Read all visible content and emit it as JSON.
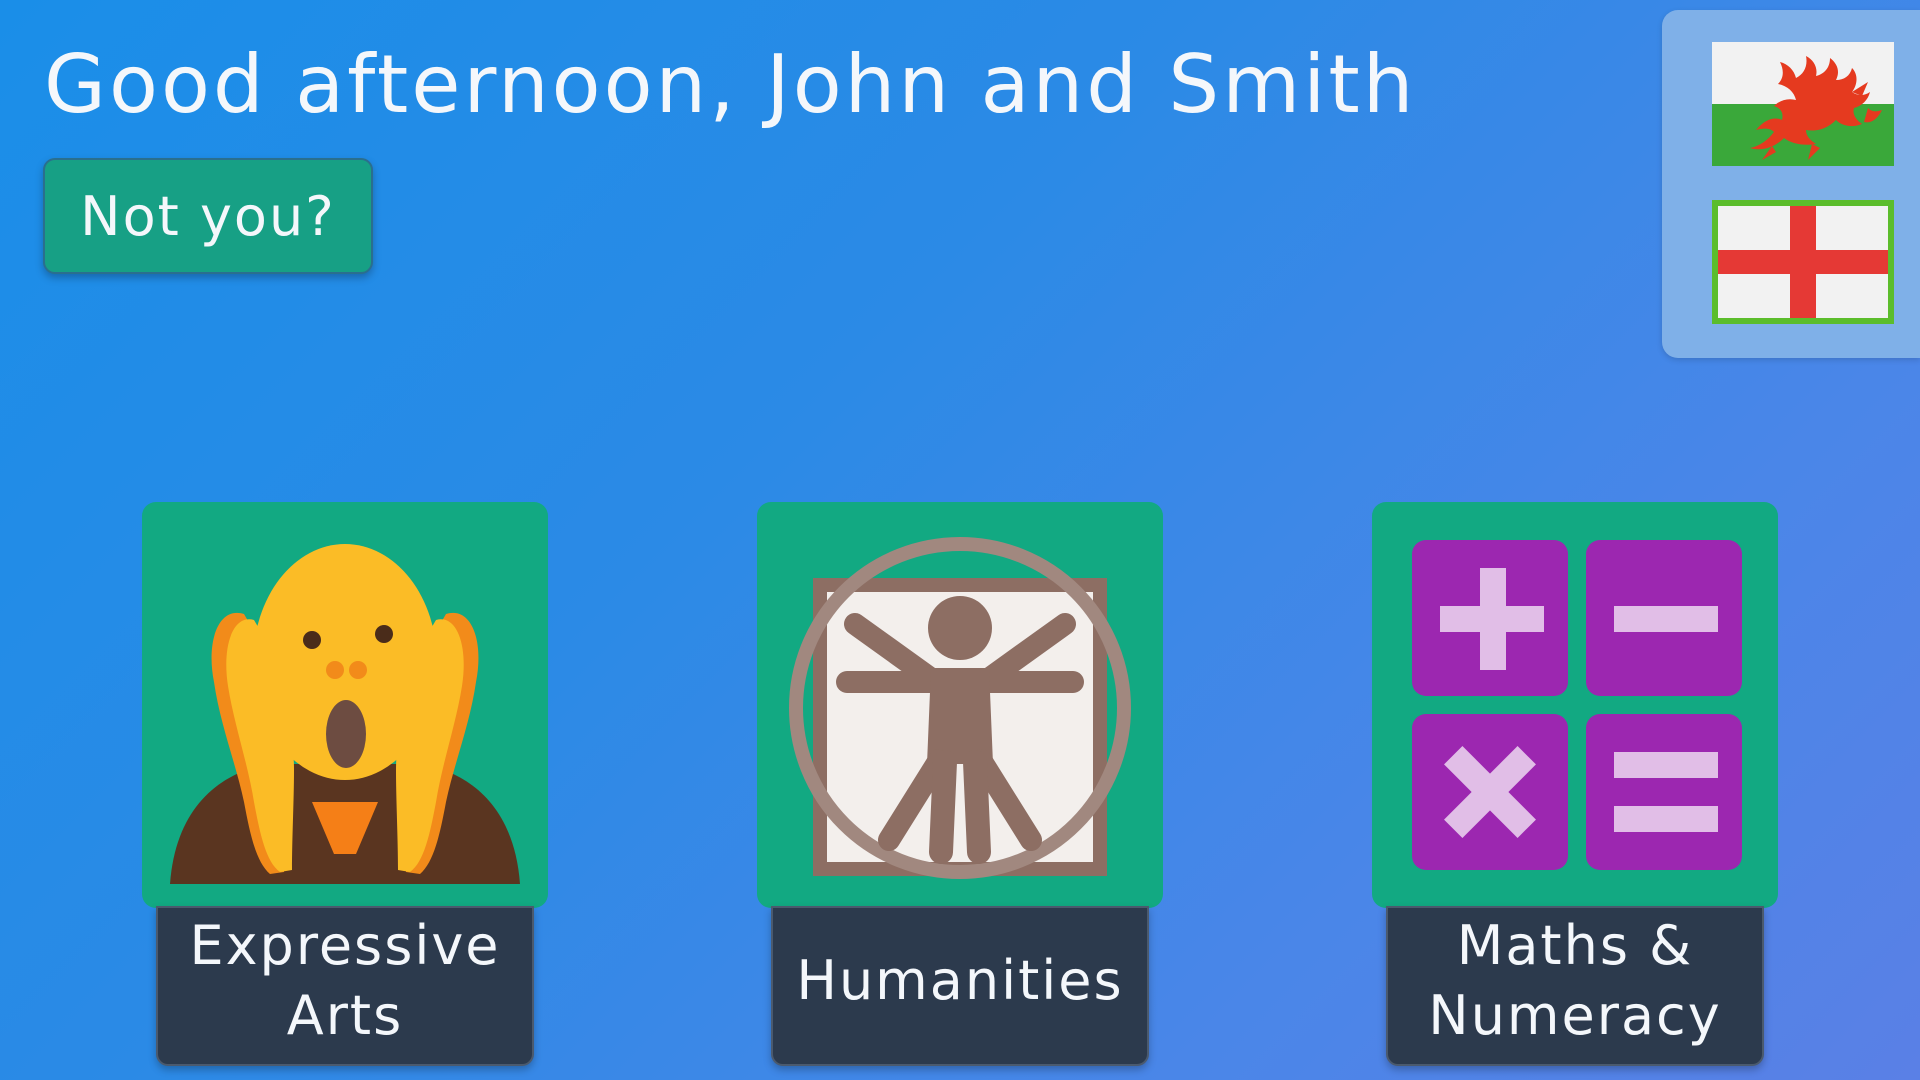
{
  "header": {
    "greeting": "Good afternoon, John and Smith",
    "not_you_label": "Not you?"
  },
  "language_switcher": {
    "options": [
      {
        "icon": "welsh-flag-icon",
        "selected": false
      },
      {
        "icon": "english-flag-icon",
        "selected": true
      }
    ],
    "selected_border_color": "#5bbd2c"
  },
  "subjects": [
    {
      "label": "Expressive Arts",
      "icon": "scream-face-icon"
    },
    {
      "label": "Humanities",
      "icon": "vitruvian-man-icon"
    },
    {
      "label": "Maths & Numeracy",
      "icon": "calculator-symbols-icon"
    }
  ],
  "colors": {
    "tile_background": "#12a982",
    "label_background": "#2c3a4d",
    "button_background": "#17a085",
    "maths_key": "#9c27b0",
    "maths_symbol": "#e1bee7"
  }
}
